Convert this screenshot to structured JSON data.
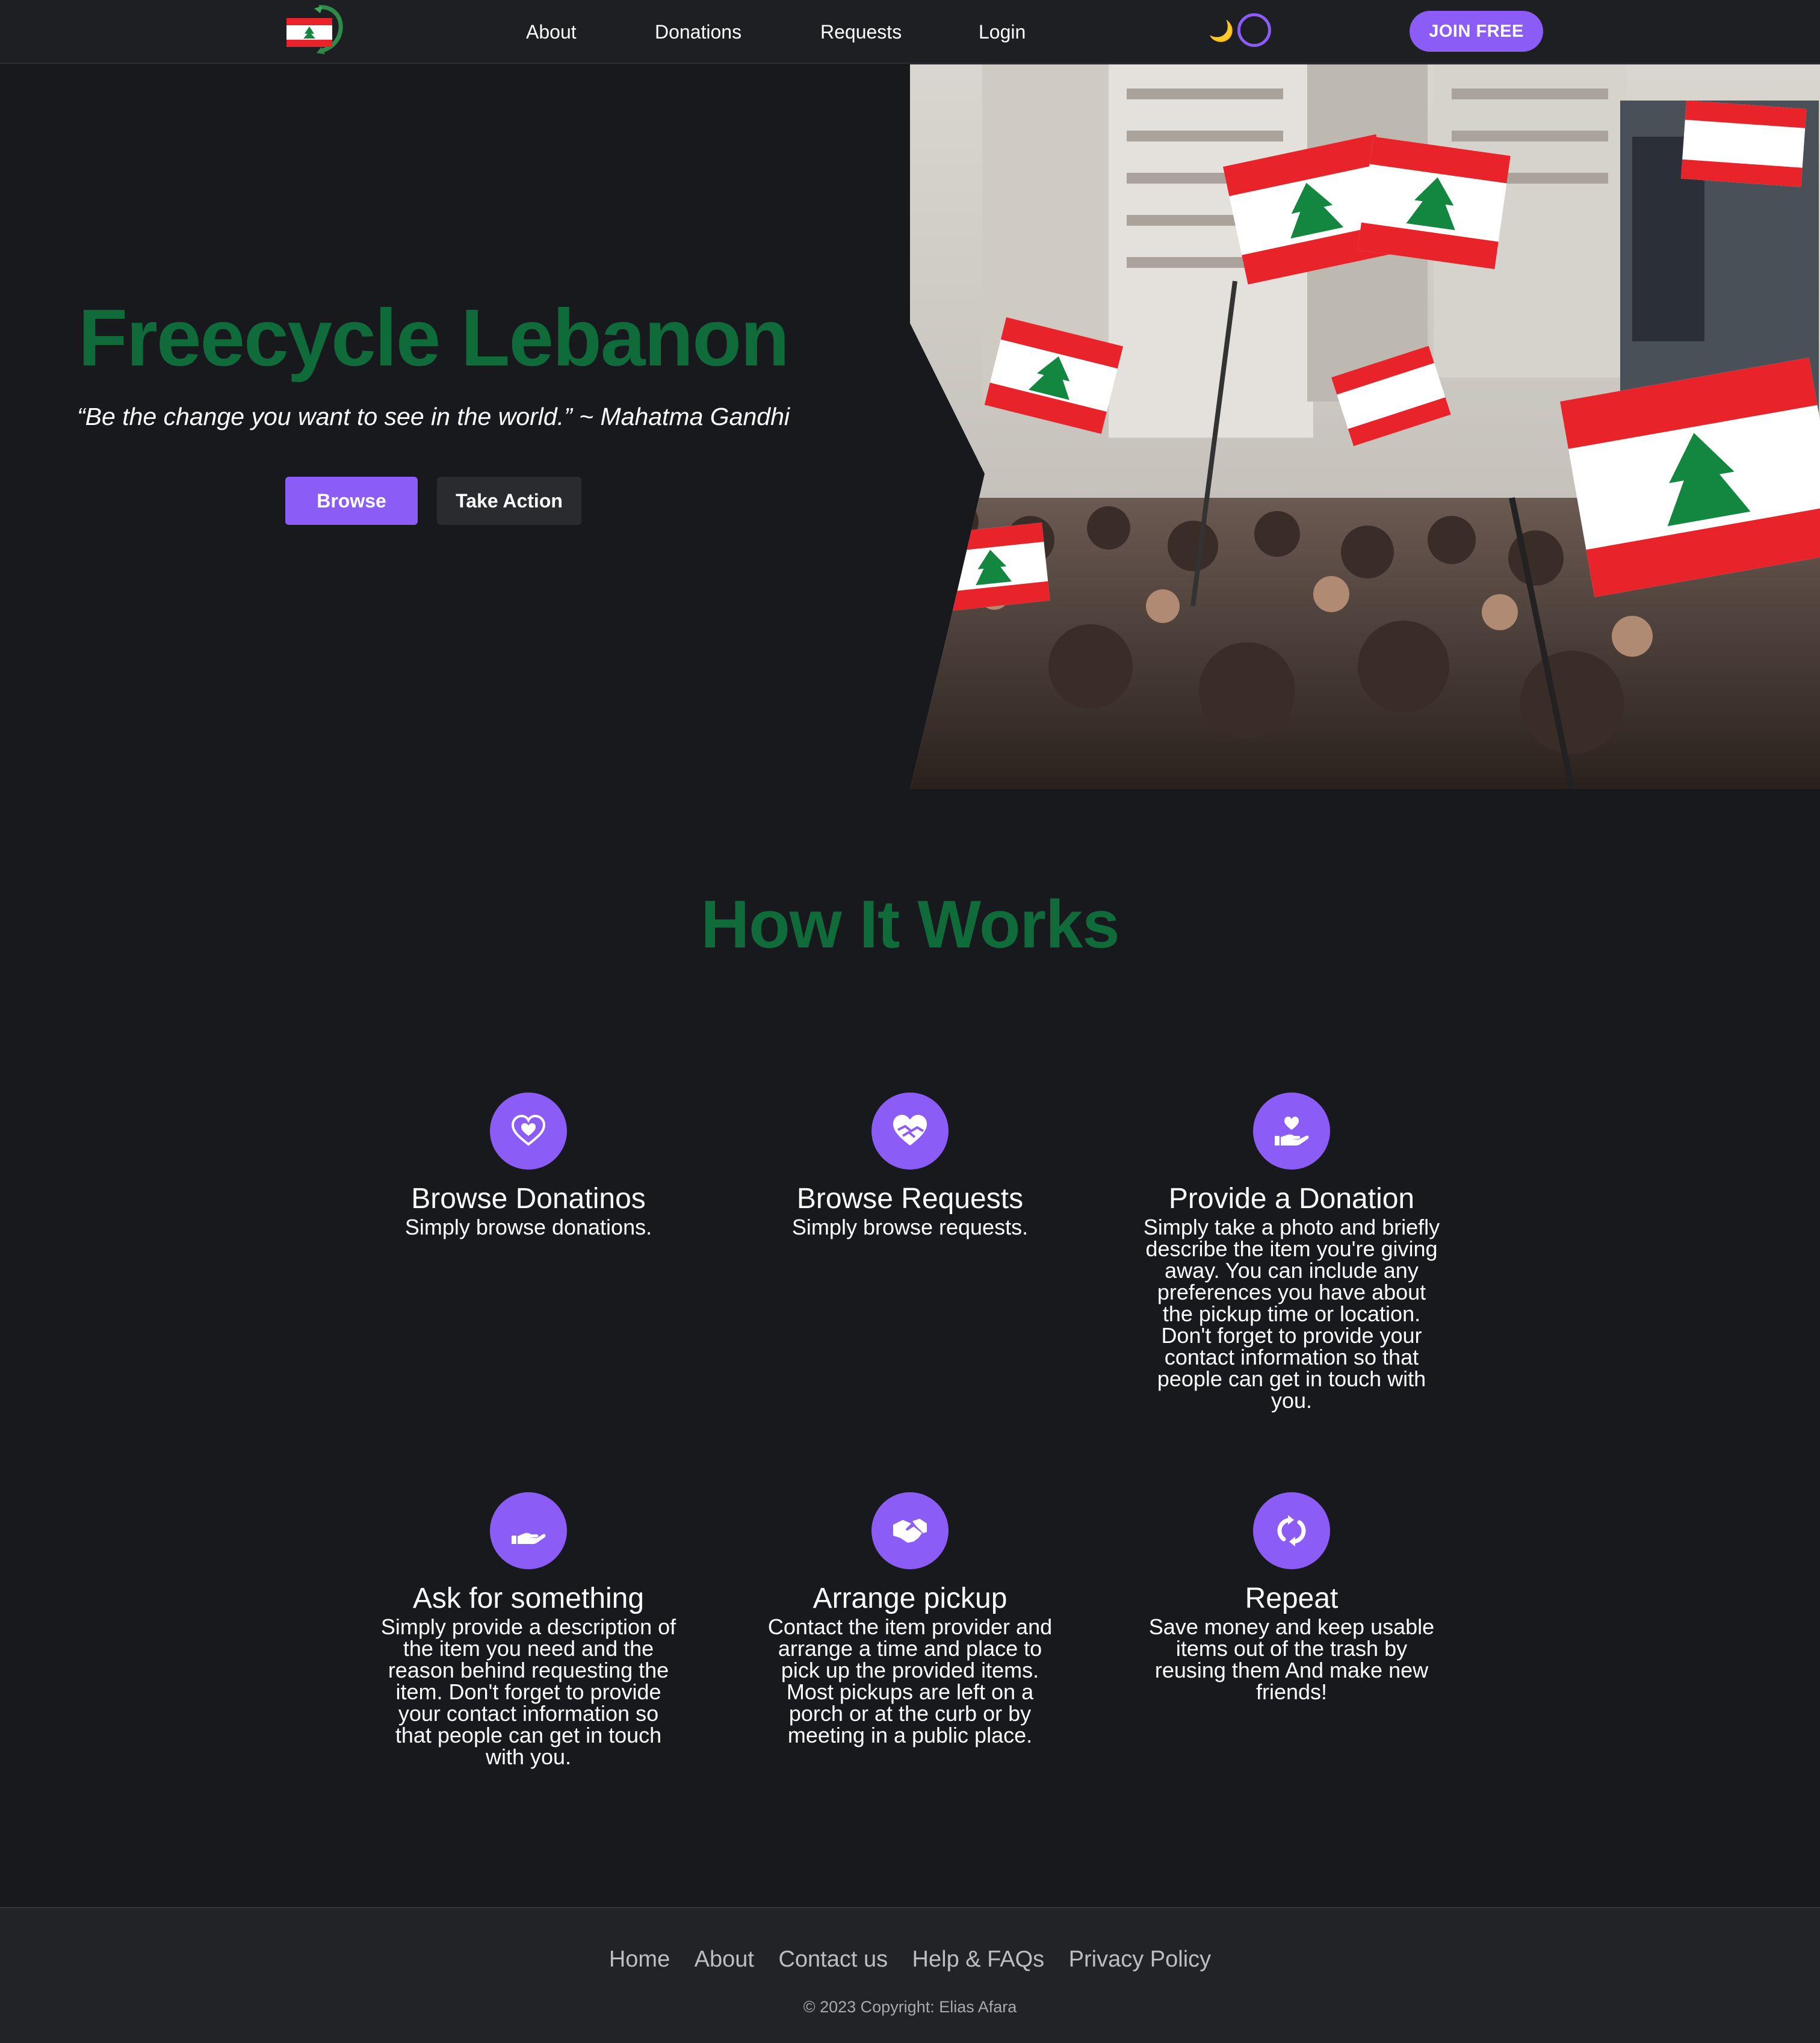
{
  "nav": {
    "links": [
      "About",
      "Donations",
      "Requests",
      "Login"
    ],
    "join_label": "JOIN FREE",
    "moon_glyph": "🌙"
  },
  "hero": {
    "title": "Freecycle Lebanon",
    "quote": "“Be the change you want to see in the world.” ~ Mahatma Gandhi",
    "browse_label": "Browse",
    "action_label": "Take Action"
  },
  "how": {
    "title": "How It Works",
    "features": [
      {
        "icon": "heart-icon",
        "title": "Browse Donatinos",
        "text": "Simply browse donations."
      },
      {
        "icon": "hands-heart-icon",
        "title": "Browse Requests",
        "text": "Simply browse requests."
      },
      {
        "icon": "hand-holding-heart-icon",
        "title": "Provide a Donation",
        "text": "Simply take a photo and briefly describe the item you're giving away. You can include any preferences you have about the pickup time or location. Don't forget to provide your contact information so that people can get in touch with you."
      },
      {
        "icon": "open-hand-icon",
        "title": "Ask for something",
        "text": "Simply provide a description of the item you need and the reason behind requesting the item. Don't forget to provide your contact information so that people can get in touch with you."
      },
      {
        "icon": "handshake-icon",
        "title": "Arrange pickup",
        "text": "Contact the item provider and arrange a time and place to pick up the provided items. Most pickups are left on a porch or at the curb or by meeting in a public place."
      },
      {
        "icon": "repeat-icon",
        "title": "Repeat",
        "text": "Save money and keep usable items out of the trash by reusing them And make new friends!"
      }
    ]
  },
  "footer": {
    "links": [
      "Home",
      "About",
      "Contact us",
      "Help & FAQs",
      "Privacy Policy"
    ],
    "copyright": "© 2023 Copyright: Elias Afara"
  },
  "colors": {
    "accent": "#8b5cf6",
    "brand_green": "#0f6b3a",
    "background": "#18191c",
    "flag_red": "#e8232a",
    "flag_green": "#13873f"
  }
}
